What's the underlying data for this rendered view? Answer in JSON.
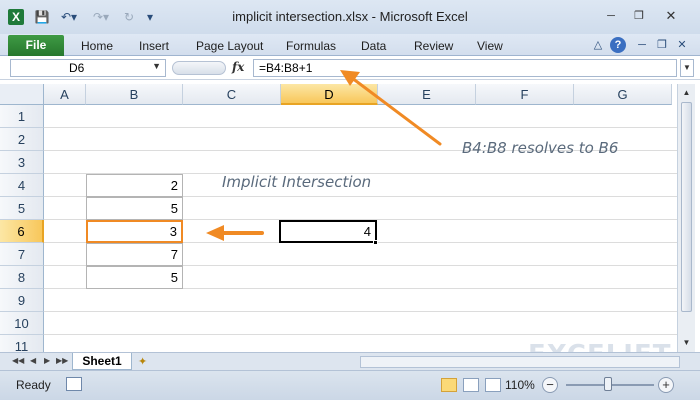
{
  "window": {
    "title": "implicit intersection.xlsx - Microsoft Excel",
    "controls": [
      "minimize-icon",
      "restore-icon",
      "close-icon"
    ]
  },
  "qat": {
    "icons": [
      "excel-logo-icon",
      "save-icon",
      "undo-icon",
      "redo-icon",
      "repeat-icon",
      "customize-qat-icon"
    ]
  },
  "ribbon": {
    "file_label": "File",
    "tabs": [
      "Home",
      "Insert",
      "Page Layout",
      "Formulas",
      "Data",
      "Review",
      "View"
    ],
    "right_icons": [
      "minimize-ribbon-icon",
      "help-icon",
      "window-minimize-icon",
      "window-restore-icon",
      "window-close-icon"
    ],
    "help_glyph": "?"
  },
  "formula_bar": {
    "name_box": "D6",
    "fx": "fx",
    "formula": "=B4:B8+1"
  },
  "columns": [
    "A",
    "B",
    "C",
    "D",
    "E",
    "F",
    "G"
  ],
  "rows": [
    "1",
    "2",
    "3",
    "4",
    "5",
    "6",
    "7",
    "8",
    "9",
    "10",
    "11"
  ],
  "selected": {
    "column": "D",
    "row": "6"
  },
  "cells": {
    "B4": "2",
    "B5": "5",
    "B6": "3",
    "B7": "7",
    "B8": "5",
    "D6": "4"
  },
  "annotations": {
    "resolves": "B4:B8 resolves to B6",
    "heading": "Implicit Intersection"
  },
  "sheet_tabs": [
    "Sheet1"
  ],
  "status": {
    "ready": "Ready",
    "zoom": "110%",
    "zoom_level": 110,
    "zoom_minus": "−",
    "zoom_plus": "+"
  },
  "watermark": "EXCELJET",
  "colors": {
    "accent_orange": "#f08a24",
    "file_tab_green": "#2f8a35",
    "selected_header": "#f8c75b"
  }
}
